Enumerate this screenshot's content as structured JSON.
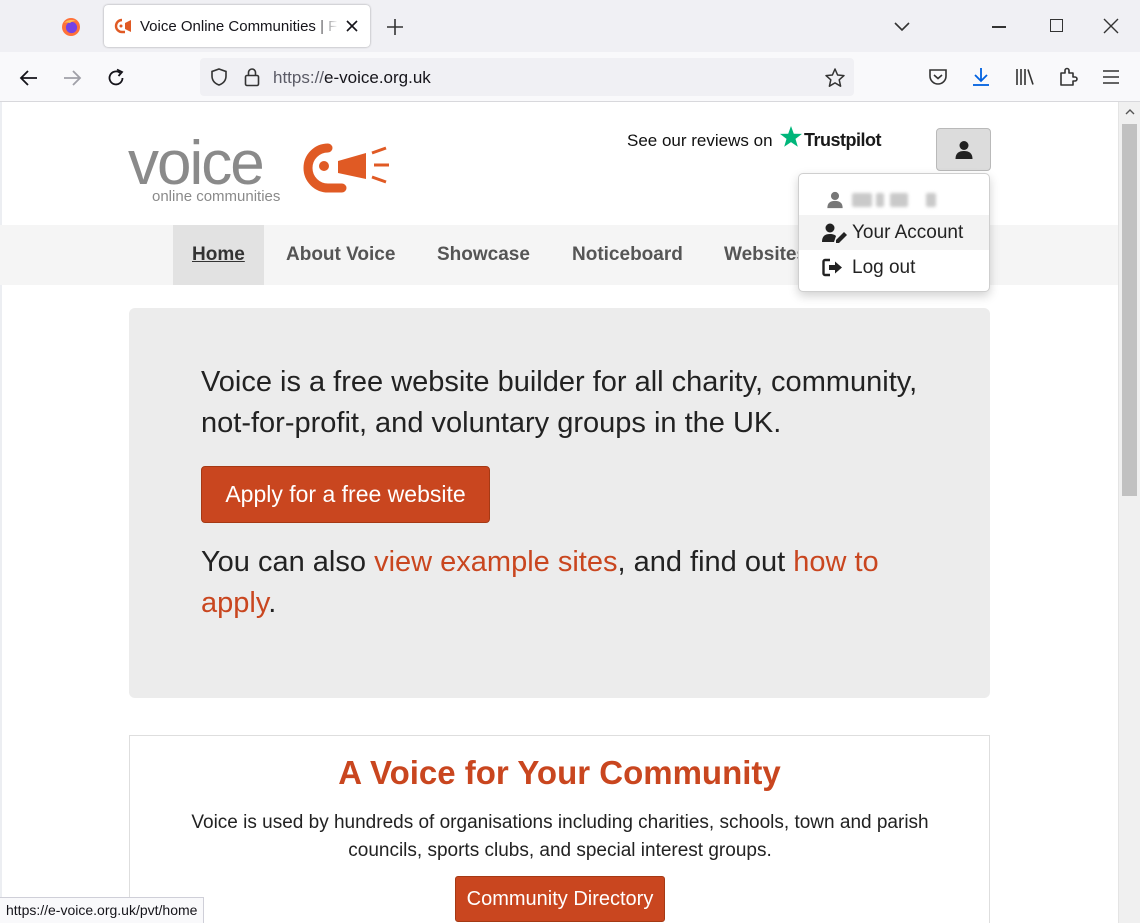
{
  "browser": {
    "tab_title": "Voice Online Communities | Free Websites for Charities",
    "url_protocol": "https://",
    "url_host": "e-voice.org.uk",
    "status_url": "https://e-voice.org.uk/pvt/home"
  },
  "header": {
    "logo_word": "voice",
    "logo_tagline": "online communities",
    "reviews_text": "See our reviews on",
    "trustpilot": "Trustpilot"
  },
  "nav": {
    "items": [
      {
        "label": "Home"
      },
      {
        "label": "About Voice"
      },
      {
        "label": "Showcase"
      },
      {
        "label": "Noticeboard"
      },
      {
        "label": "Websites"
      }
    ]
  },
  "user_menu": {
    "items": [
      {
        "label": "Your Account"
      },
      {
        "label": "Log out"
      }
    ]
  },
  "hero": {
    "text": "Voice is a free website builder for all charity, community, not-for-profit, and voluntary groups in the UK.",
    "apply_button": "Apply for a free website",
    "also_prefix": "You can also ",
    "also_link1": "view example sites",
    "also_middle": ", and find out ",
    "also_link2": "how to apply",
    "also_suffix": "."
  },
  "community": {
    "title": "A Voice for Your Community",
    "text": "Voice is used by hundreds of organisations including charities, schools, town and parish councils, sports clubs, and special interest groups.",
    "directory_button": "Community Directory"
  },
  "colors": {
    "brand_orange": "#c9461f",
    "logo_grey": "#8a8a8a",
    "logo_orange": "#e05a24",
    "trustpilot_green": "#00b67a"
  }
}
